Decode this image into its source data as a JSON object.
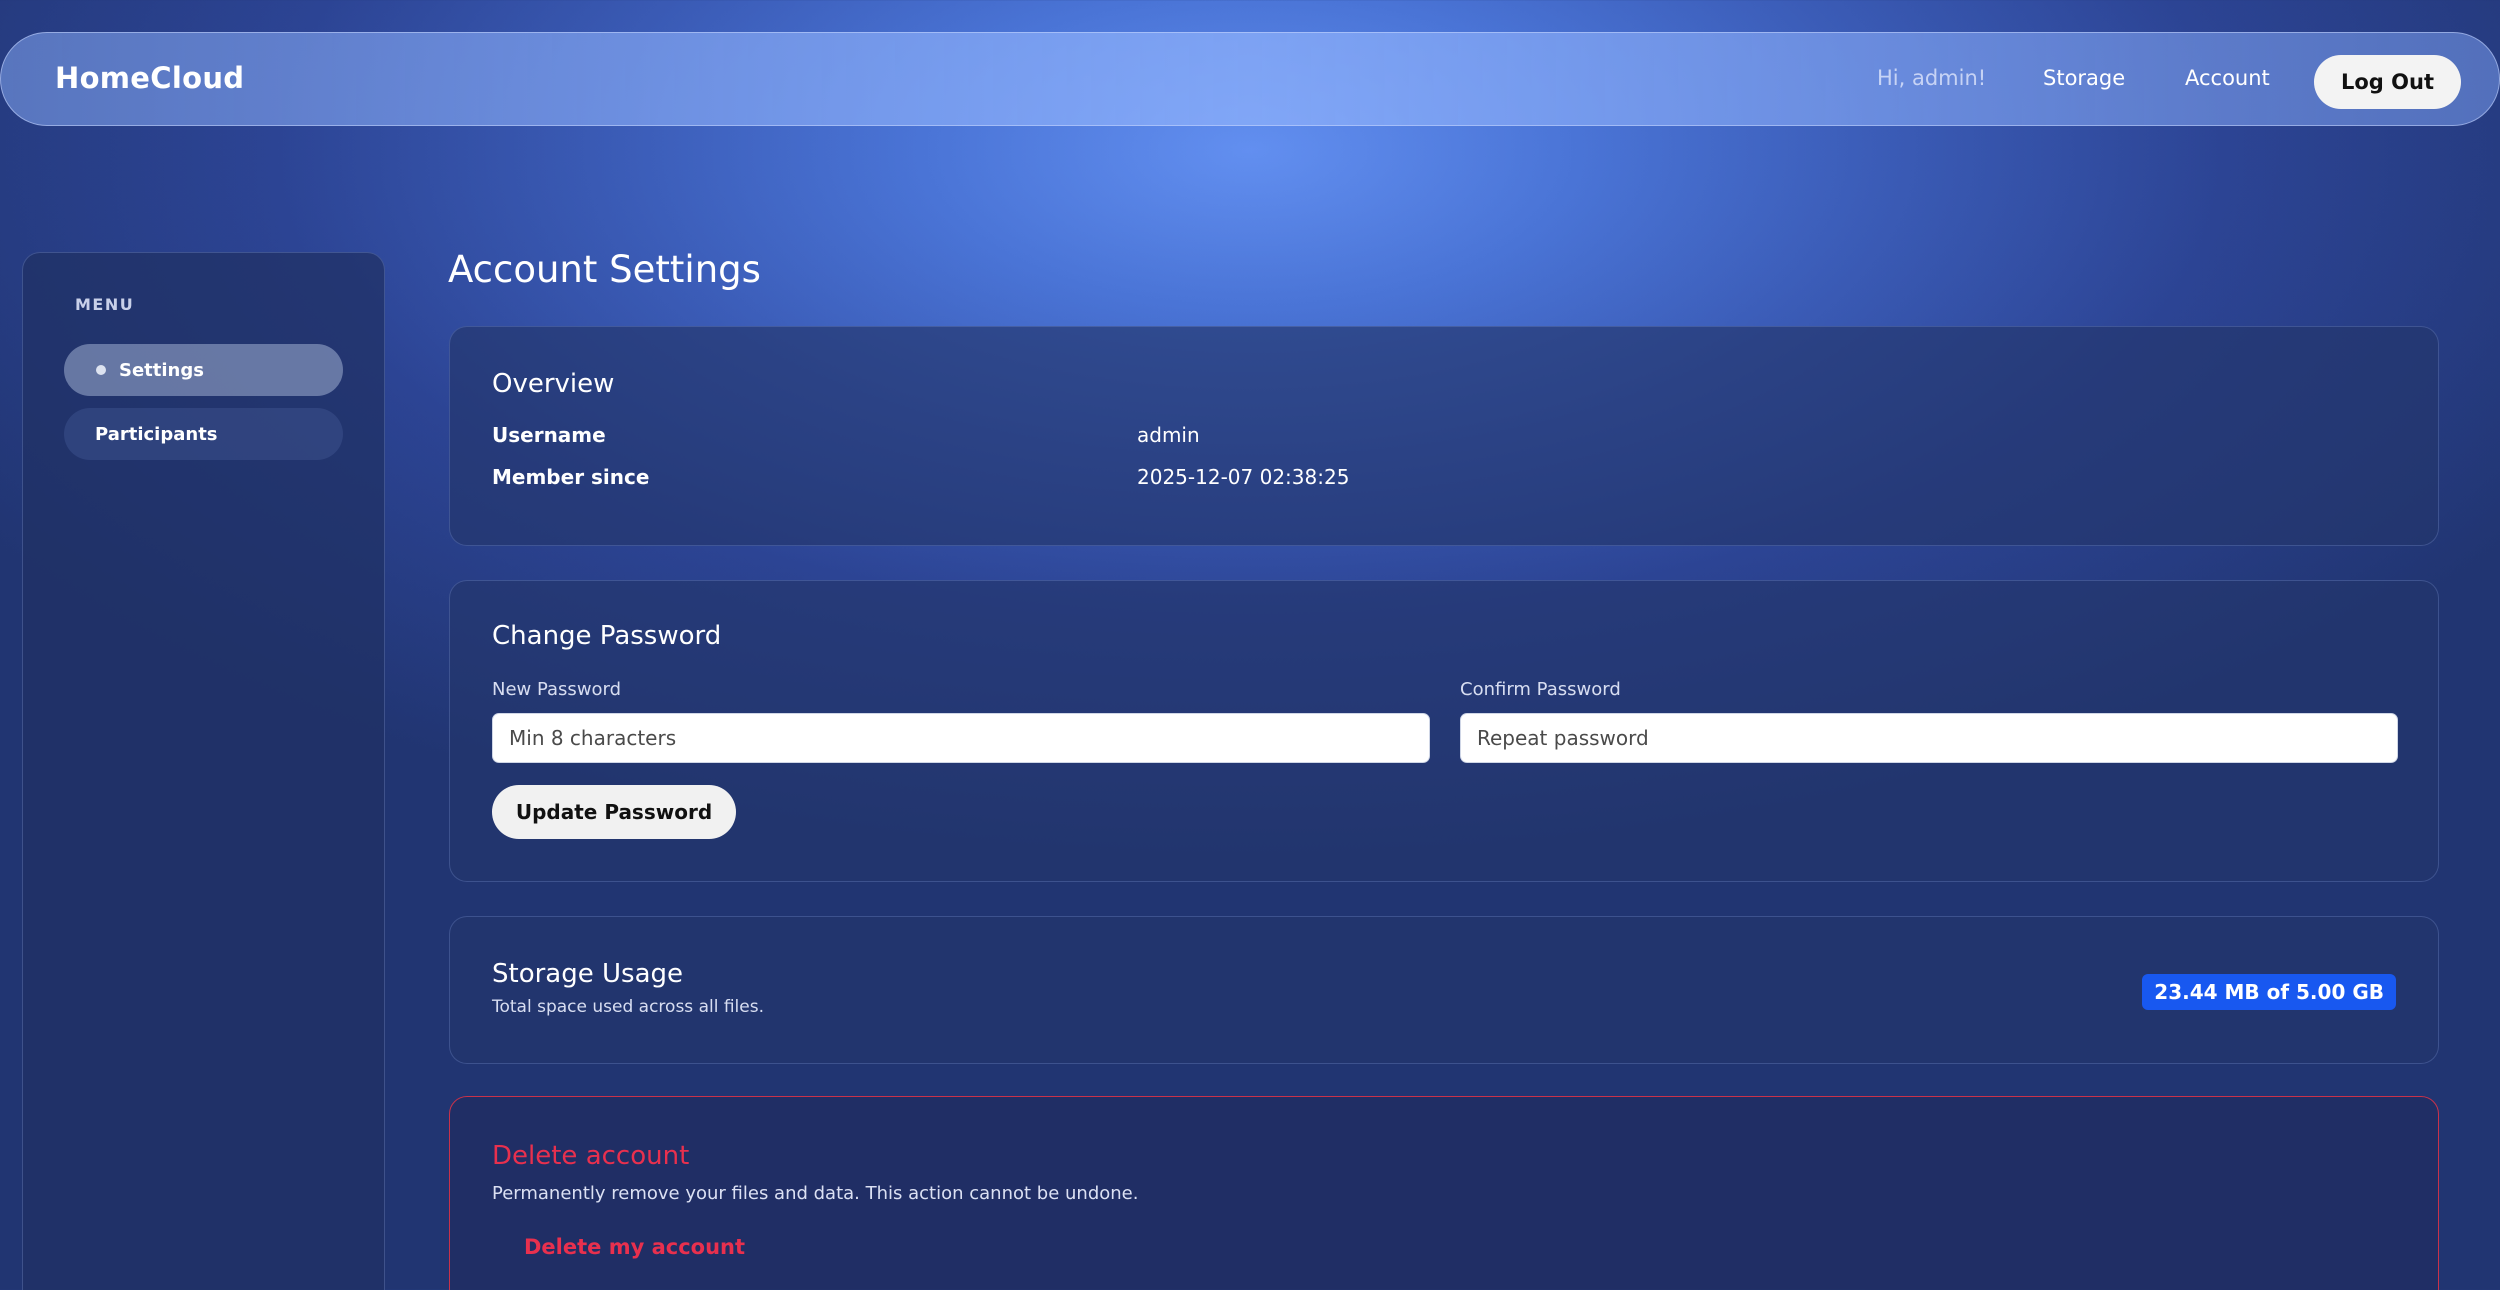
{
  "nav": {
    "brand": "HomeCloud",
    "greeting": "Hi, admin!",
    "links": [
      "Storage",
      "Account"
    ],
    "logout_label": "Log Out"
  },
  "sidebar": {
    "heading": "MENU",
    "items": [
      {
        "label": "Settings",
        "active": true
      },
      {
        "label": "Participants",
        "active": false
      }
    ]
  },
  "main": {
    "title": "Account Settings",
    "overview": {
      "title": "Overview",
      "rows": [
        {
          "label": "Username",
          "value": "admin"
        },
        {
          "label": "Member since",
          "value": "2025-12-07 02:38:25"
        }
      ]
    },
    "password": {
      "title": "Change Password",
      "new_label": "New Password",
      "new_placeholder": "Min 8 characters",
      "new_value": "",
      "confirm_label": "Confirm Password",
      "confirm_placeholder": "Repeat password",
      "confirm_value": "",
      "button_label": "Update Password"
    },
    "storage": {
      "title": "Storage Usage",
      "subtitle": "Total space used across all files.",
      "badge": "23.44 MB of 5.00 GB"
    },
    "delete": {
      "title": "Delete account",
      "description": "Permanently remove your files and data. This action cannot be undone.",
      "button_label": "Delete my account"
    }
  },
  "colors": {
    "accent_blue": "#1858f0",
    "danger_red": "#e8304e"
  }
}
